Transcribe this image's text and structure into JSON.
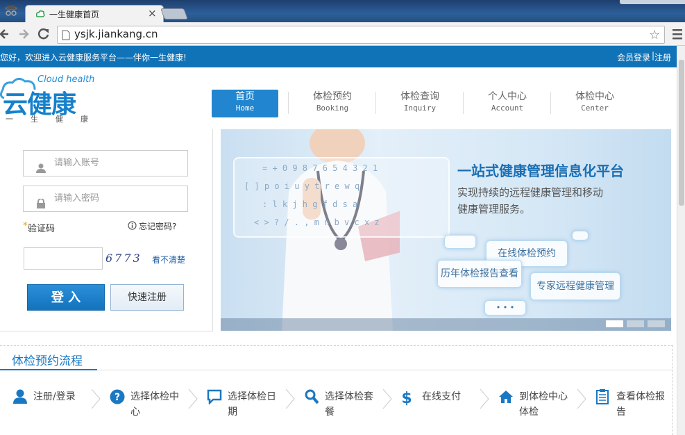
{
  "browser": {
    "tab_title": "一生健康首页",
    "tab_close": "×",
    "url": "ysjk.jiankang.cn"
  },
  "welcome": {
    "text": "您好，欢迎进入云健康服务平台——伴你一生健康!",
    "member_login": "会员登录",
    "separator": "|",
    "register": "注册"
  },
  "logo": {
    "en": "Cloud health",
    "cn": "云健康",
    "slogan": [
      "一",
      "生",
      "健",
      "康"
    ]
  },
  "nav": [
    {
      "cn": "首页",
      "en": "Home",
      "active": true
    },
    {
      "cn": "体检预约",
      "en": "Booking",
      "active": false
    },
    {
      "cn": "体检查询",
      "en": "Inquiry",
      "active": false
    },
    {
      "cn": "个人中心",
      "en": "Account",
      "active": false
    },
    {
      "cn": "体检中心",
      "en": "Center",
      "active": false
    }
  ],
  "login": {
    "account_placeholder": "请输入账号",
    "password_placeholder": "请输入密码",
    "captcha_mark": "*",
    "captcha_label": "验证码",
    "forgot": "忘记密码?",
    "captcha_code": "6773",
    "refresh_captcha": "看不清楚",
    "login_button": "登 入",
    "quick_register": "快速注册"
  },
  "banner": {
    "headline": "一站式健康管理信息化平台",
    "sub1": "实现持续的远程健康管理和移动",
    "sub2": "健康管理服务。",
    "chip_online": "在线体检预约",
    "chip_history": "历年体检报告查看",
    "chip_expert": "专家远程健康管理",
    "chip_dots": "• • •"
  },
  "process": {
    "title": "体检预约流程",
    "steps": [
      {
        "icon": "user-icon",
        "line1": "注册/登录",
        "line2": ""
      },
      {
        "icon": "question-icon",
        "line1": "选择体检中",
        "line2": "心"
      },
      {
        "icon": "chat-icon",
        "line1": "选择体检日",
        "line2": "期"
      },
      {
        "icon": "search-icon",
        "line1": "选择体检套",
        "line2": "餐"
      },
      {
        "icon": "dollar-icon",
        "line1": "在线支付",
        "line2": ""
      },
      {
        "icon": "home-icon",
        "line1": "到体检中心",
        "line2": "体检"
      },
      {
        "icon": "clipboard-icon",
        "line1": "查看体检报",
        "line2": "告"
      }
    ]
  },
  "colors": {
    "primary": "#1073b8",
    "accent": "#2b8fd8",
    "text": "#444444"
  }
}
